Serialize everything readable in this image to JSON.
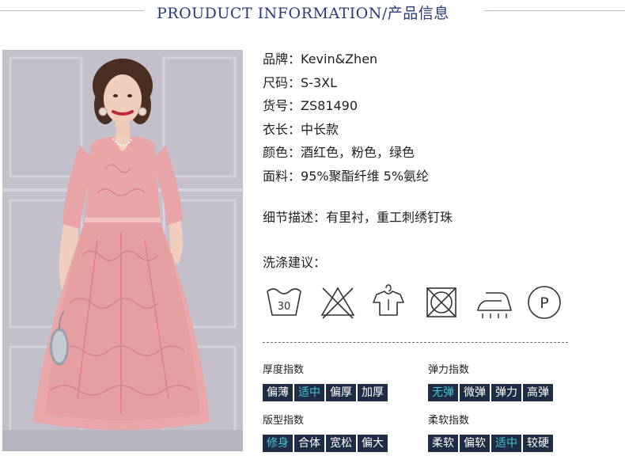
{
  "header": {
    "title": "PROUDUCT INFORMATION/产品信息"
  },
  "info": [
    {
      "label": "品牌：",
      "value": "Kevin&Zhen"
    },
    {
      "label": "尺码：",
      "value": "S-3XL"
    },
    {
      "label": "货号：",
      "value": "ZS81490"
    },
    {
      "label": "衣长：",
      "value": "中长款"
    },
    {
      "label": "颜色：",
      "value": "酒红色，粉色，绿色"
    },
    {
      "label": "面料：",
      "value": "95%聚酯纤维 5%氨纶"
    }
  ],
  "detail": {
    "label": "细节描述：",
    "value": "有里衬，重工刺绣钉珠"
  },
  "washing": {
    "title": "洗涤建议：",
    "icons": [
      "wash-30-icon",
      "no-bleach-icon",
      "hang-dry-icon",
      "no-tumble-dry-icon",
      "iron-low-icon",
      "dry-clean-p-icon"
    ],
    "wash_temp": "30",
    "dry_clean_letter": "P"
  },
  "indices": [
    {
      "label": "厚度指数",
      "options": [
        "偏薄",
        "适中",
        "偏厚",
        "加厚"
      ],
      "active": 1
    },
    {
      "label": "弹力指数",
      "options": [
        "无弹",
        "微弹",
        "弹力",
        "高弹"
      ],
      "active": 0
    },
    {
      "label": "版型指数",
      "options": [
        "修身",
        "合体",
        "宽松",
        "偏大"
      ],
      "active": 0
    },
    {
      "label": "柔软指数",
      "options": [
        "柔软",
        "偏软",
        "适中",
        "较硬"
      ],
      "active": 2
    }
  ],
  "colors": {
    "chip_bg": "#1f2d44",
    "chip_active_text": "#41c5d8",
    "chip_text": "#ffffff",
    "header_text": "#2a3a7a",
    "dress_pink": "#e9a6a6"
  }
}
